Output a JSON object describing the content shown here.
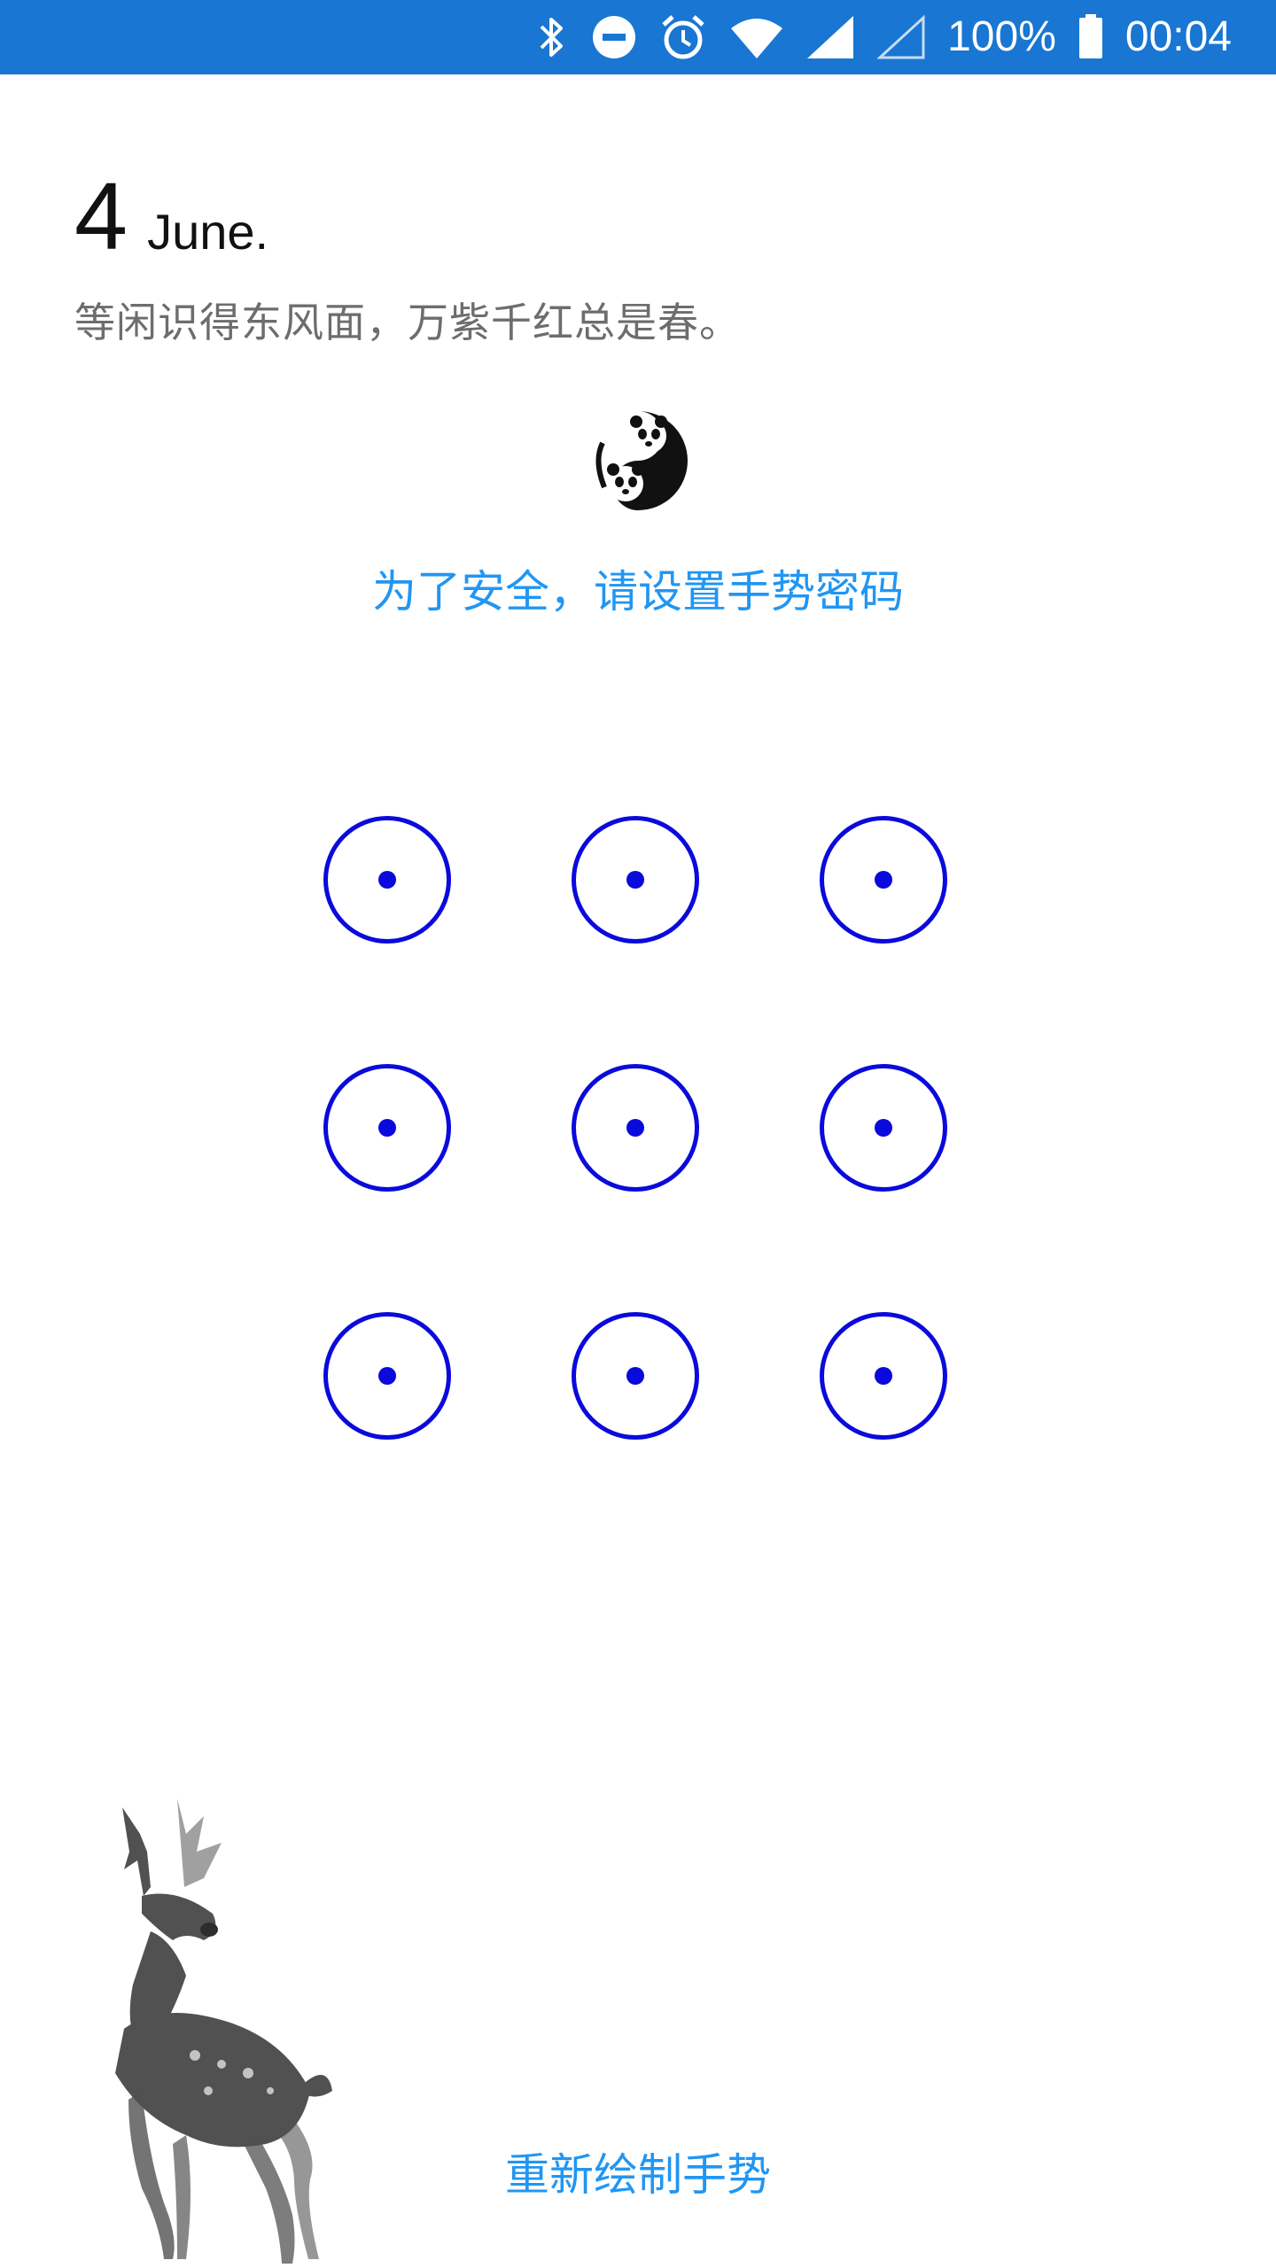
{
  "status_bar": {
    "battery": "100%",
    "time": "00:04",
    "icons": [
      "bluetooth-icon",
      "do-not-disturb-icon",
      "alarm-icon",
      "wifi-icon",
      "signal-icon",
      "signal-empty-icon",
      "battery-icon"
    ],
    "background_color": "#1976d2"
  },
  "header": {
    "day": "4",
    "month": "June.",
    "poem": "等闲识得东风面，万紫千红总是春。"
  },
  "lock_screen": {
    "avatar_icon": "panda-icon",
    "prompt": "为了安全，请设置手势密码",
    "grid": {
      "rows": 3,
      "cols": 3,
      "node_color": "#0a0adc"
    },
    "redraw_label": "重新绘制手势"
  },
  "decoration": {
    "illustration": "deer-illustration"
  },
  "colors": {
    "accent": "#2196f3",
    "poem_text": "#6d6d6d",
    "node": "#0a0adc"
  }
}
